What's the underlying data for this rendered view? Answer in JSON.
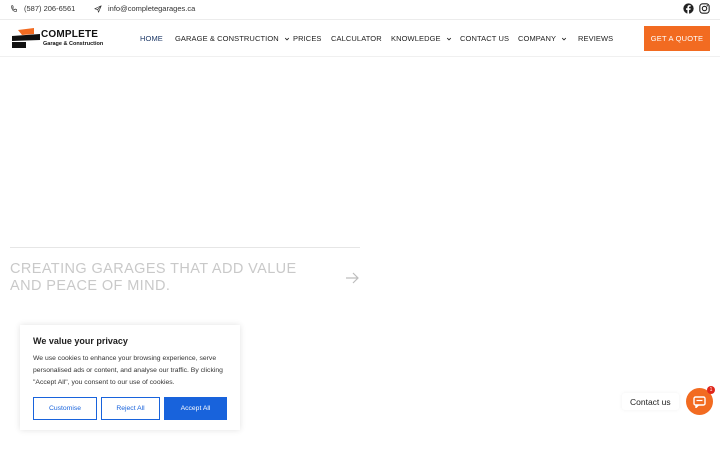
{
  "topbar": {
    "phone": "(587) 206-6561",
    "email": "info@completegarages.ca",
    "social": [
      "facebook-icon",
      "instagram-icon"
    ]
  },
  "logo": {
    "title": "COMPLETE",
    "subtitle": "Garage & Construction"
  },
  "nav": {
    "items": [
      {
        "label": "HOME",
        "active": true
      },
      {
        "label": "GARAGE & CONSTRUCTION",
        "dropdown": true
      },
      {
        "label": "PRICES"
      },
      {
        "label": "CALCULATOR"
      },
      {
        "label": "KNOWLEDGE",
        "dropdown": true
      },
      {
        "label": "CONTACT US"
      },
      {
        "label": "COMPANY",
        "dropdown": true
      },
      {
        "label": "REVIEWS"
      }
    ],
    "cta": "GET A QUOTE"
  },
  "hero": {
    "heading": "CREATING GARAGES THAT ADD VALUE AND PEACE OF MIND."
  },
  "cookie": {
    "title": "We value your privacy",
    "text": "We use cookies to enhance your browsing experience, serve personalised ads or content, and analyse our traffic. By clicking \"Accept All\", you consent to our use of cookies.",
    "customise": "Customise",
    "reject": "Reject All",
    "accept": "Accept All"
  },
  "contact": {
    "label": "Contact us",
    "badge": "1"
  },
  "colors": {
    "accent": "#f26b21",
    "nav_active": "#1f3a68",
    "cookie_blue": "#1863dc",
    "badge": "#e0261b"
  }
}
